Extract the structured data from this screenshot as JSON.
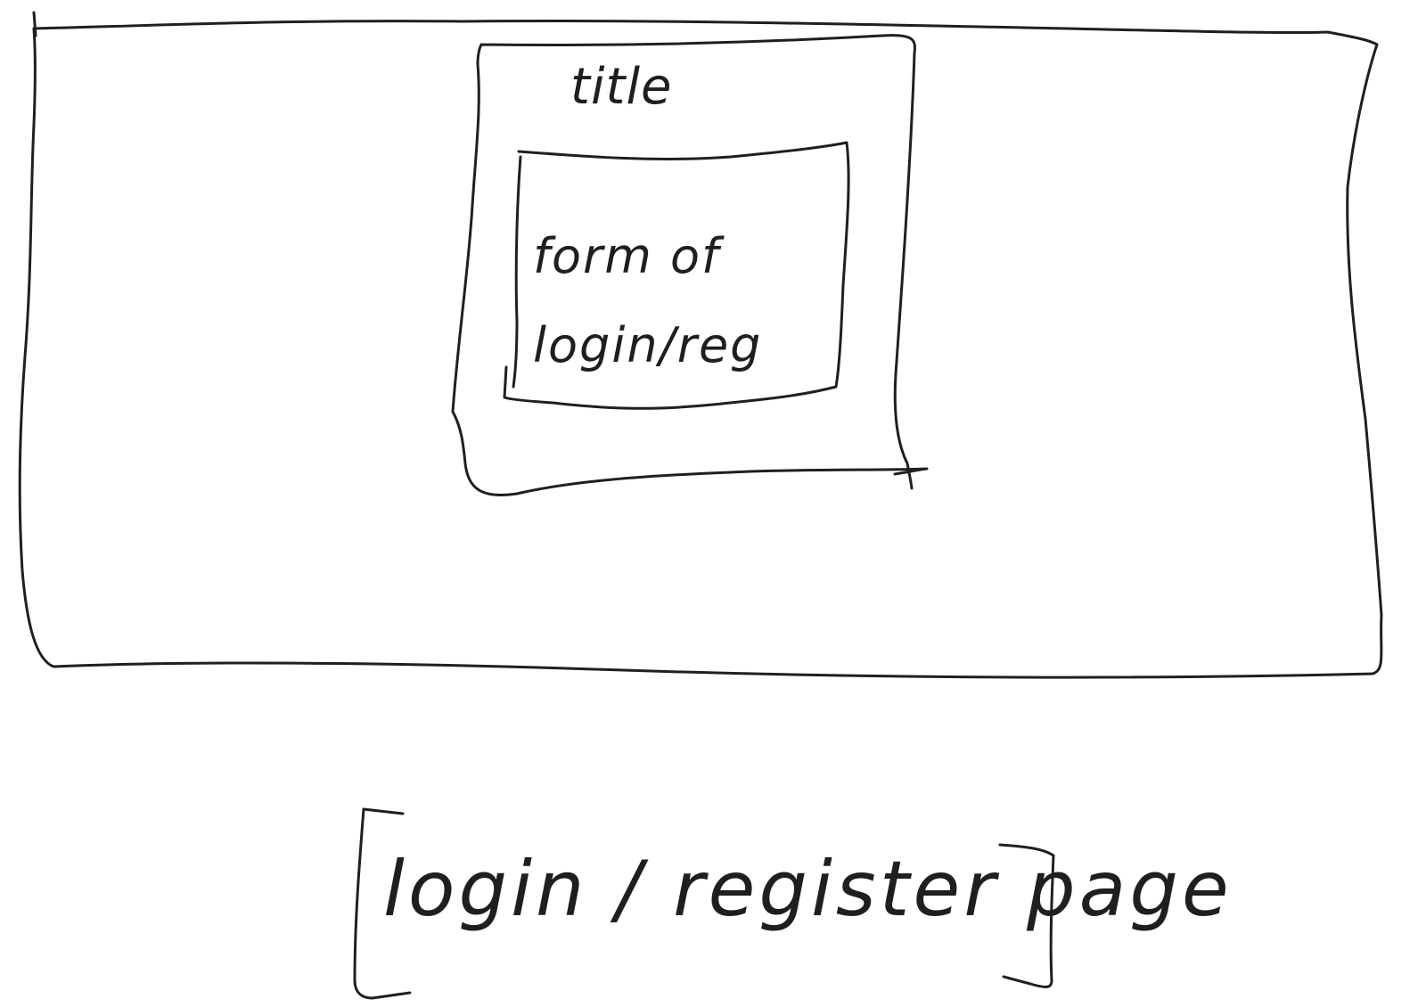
{
  "diagram": {
    "title": "title",
    "form_label": "form of login/reg",
    "caption": "login / register page"
  }
}
